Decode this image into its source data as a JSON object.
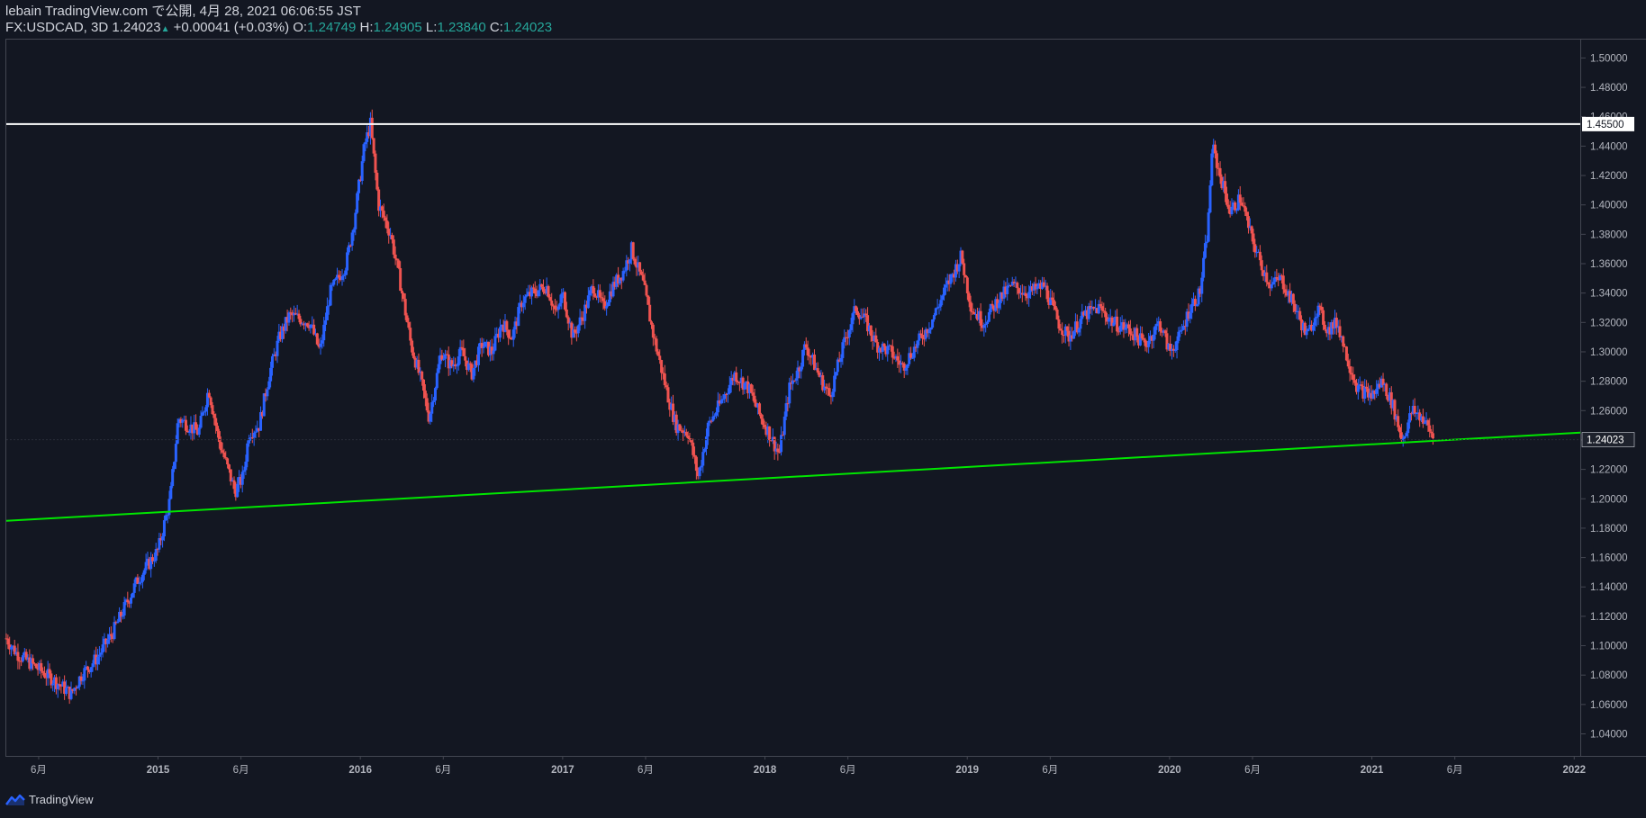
{
  "header": {
    "line1": "lebain TradingView.com で公開, 4月 28, 2021 06:06:55 JST",
    "symbol": "FX:USDCAD, 3D 1.24023",
    "change_icon": "up-triangle-icon",
    "change": "+0.00041 (+0.03%)",
    "open_label": "O:",
    "open": "1.24749",
    "high_label": "H:",
    "high": "1.24905",
    "low_label": "L:",
    "low": "1.23840",
    "close_label": "C:",
    "close": "1.24023"
  },
  "footer": {
    "brand": "TradingView",
    "logo_icon": "tradingview-logo-icon"
  },
  "colors": {
    "background": "#131722",
    "up": "#2962ff",
    "down": "#ef5350",
    "resistance": "#ffffff",
    "support": "#00e600",
    "axis_text": "#b2b5be"
  },
  "chart_data": {
    "type": "candlestick",
    "symbol": "FX:USDCAD",
    "interval": "3D",
    "ylim": [
      1.025,
      1.5125
    ],
    "xlim": [
      2014.25,
      2022.03
    ],
    "y_ticks": [
      "1.50000",
      "1.48000",
      "1.46000",
      "1.44000",
      "1.42000",
      "1.40000",
      "1.38000",
      "1.36000",
      "1.34000",
      "1.32000",
      "1.30000",
      "1.28000",
      "1.26000",
      "1.24000",
      "1.22000",
      "1.20000",
      "1.18000",
      "1.16000",
      "1.14000",
      "1.12000",
      "1.10000",
      "1.08000",
      "1.06000",
      "1.04000"
    ],
    "x_ticks": [
      {
        "label": "6月",
        "t": 2014.41
      },
      {
        "label": "2015",
        "t": 2015.0
      },
      {
        "label": "6月",
        "t": 2015.41
      },
      {
        "label": "2016",
        "t": 2016.0
      },
      {
        "label": "6月",
        "t": 2016.41
      },
      {
        "label": "2017",
        "t": 2017.0
      },
      {
        "label": "6月",
        "t": 2017.41
      },
      {
        "label": "2018",
        "t": 2018.0
      },
      {
        "label": "6月",
        "t": 2018.41
      },
      {
        "label": "2019",
        "t": 2019.0
      },
      {
        "label": "6月",
        "t": 2019.41
      },
      {
        "label": "2020",
        "t": 2020.0
      },
      {
        "label": "6月",
        "t": 2020.41
      },
      {
        "label": "2021",
        "t": 2021.0
      },
      {
        "label": "6月",
        "t": 2021.41
      },
      {
        "label": "2022",
        "t": 2022.0
      }
    ],
    "price_path": [
      [
        2014.25,
        1.105
      ],
      [
        2014.3,
        1.095
      ],
      [
        2014.4,
        1.085
      ],
      [
        2014.5,
        1.075
      ],
      [
        2014.57,
        1.067
      ],
      [
        2014.62,
        1.08
      ],
      [
        2014.7,
        1.092
      ],
      [
        2014.78,
        1.11
      ],
      [
        2014.9,
        1.145
      ],
      [
        2015.0,
        1.165
      ],
      [
        2015.06,
        1.2
      ],
      [
        2015.1,
        1.255
      ],
      [
        2015.2,
        1.245
      ],
      [
        2015.25,
        1.275
      ],
      [
        2015.3,
        1.24
      ],
      [
        2015.38,
        1.205
      ],
      [
        2015.42,
        1.215
      ],
      [
        2015.45,
        1.245
      ],
      [
        2015.5,
        1.25
      ],
      [
        2015.55,
        1.285
      ],
      [
        2015.6,
        1.31
      ],
      [
        2015.65,
        1.325
      ],
      [
        2015.75,
        1.32
      ],
      [
        2015.8,
        1.3
      ],
      [
        2015.85,
        1.34
      ],
      [
        2015.93,
        1.36
      ],
      [
        2015.97,
        1.39
      ],
      [
        2016.02,
        1.44
      ],
      [
        2016.05,
        1.455
      ],
      [
        2016.09,
        1.4
      ],
      [
        2016.15,
        1.38
      ],
      [
        2016.2,
        1.345
      ],
      [
        2016.25,
        1.305
      ],
      [
        2016.3,
        1.28
      ],
      [
        2016.34,
        1.255
      ],
      [
        2016.4,
        1.3
      ],
      [
        2016.45,
        1.29
      ],
      [
        2016.5,
        1.3
      ],
      [
        2016.55,
        1.285
      ],
      [
        2016.6,
        1.305
      ],
      [
        2016.65,
        1.3
      ],
      [
        2016.7,
        1.32
      ],
      [
        2016.75,
        1.31
      ],
      [
        2016.8,
        1.335
      ],
      [
        2016.85,
        1.34
      ],
      [
        2016.92,
        1.345
      ],
      [
        2016.97,
        1.325
      ],
      [
        2017.0,
        1.34
      ],
      [
        2017.05,
        1.31
      ],
      [
        2017.1,
        1.325
      ],
      [
        2017.15,
        1.345
      ],
      [
        2017.2,
        1.33
      ],
      [
        2017.25,
        1.345
      ],
      [
        2017.3,
        1.355
      ],
      [
        2017.34,
        1.37
      ],
      [
        2017.4,
        1.345
      ],
      [
        2017.45,
        1.31
      ],
      [
        2017.52,
        1.27
      ],
      [
        2017.56,
        1.25
      ],
      [
        2017.62,
        1.245
      ],
      [
        2017.67,
        1.215
      ],
      [
        2017.72,
        1.25
      ],
      [
        2017.78,
        1.265
      ],
      [
        2017.85,
        1.285
      ],
      [
        2017.92,
        1.275
      ],
      [
        2017.98,
        1.255
      ],
      [
        2018.02,
        1.245
      ],
      [
        2018.07,
        1.23
      ],
      [
        2018.12,
        1.275
      ],
      [
        2018.17,
        1.29
      ],
      [
        2018.2,
        1.305
      ],
      [
        2018.28,
        1.28
      ],
      [
        2018.32,
        1.27
      ],
      [
        2018.4,
        1.31
      ],
      [
        2018.45,
        1.33
      ],
      [
        2018.5,
        1.32
      ],
      [
        2018.55,
        1.305
      ],
      [
        2018.62,
        1.3
      ],
      [
        2018.68,
        1.29
      ],
      [
        2018.75,
        1.305
      ],
      [
        2018.82,
        1.32
      ],
      [
        2018.9,
        1.345
      ],
      [
        2018.97,
        1.365
      ],
      [
        2019.02,
        1.33
      ],
      [
        2019.08,
        1.32
      ],
      [
        2019.15,
        1.335
      ],
      [
        2019.22,
        1.345
      ],
      [
        2019.3,
        1.34
      ],
      [
        2019.38,
        1.345
      ],
      [
        2019.45,
        1.32
      ],
      [
        2019.5,
        1.31
      ],
      [
        2019.58,
        1.325
      ],
      [
        2019.65,
        1.33
      ],
      [
        2019.72,
        1.32
      ],
      [
        2019.8,
        1.315
      ],
      [
        2019.88,
        1.305
      ],
      [
        2019.95,
        1.32
      ],
      [
        2020.0,
        1.3
      ],
      [
        2020.05,
        1.31
      ],
      [
        2020.1,
        1.33
      ],
      [
        2020.15,
        1.34
      ],
      [
        2020.19,
        1.385
      ],
      [
        2020.21,
        1.44
      ],
      [
        2020.25,
        1.42
      ],
      [
        2020.3,
        1.395
      ],
      [
        2020.35,
        1.405
      ],
      [
        2020.4,
        1.38
      ],
      [
        2020.45,
        1.36
      ],
      [
        2020.5,
        1.345
      ],
      [
        2020.55,
        1.35
      ],
      [
        2020.62,
        1.33
      ],
      [
        2020.68,
        1.31
      ],
      [
        2020.73,
        1.33
      ],
      [
        2020.78,
        1.315
      ],
      [
        2020.83,
        1.32
      ],
      [
        2020.88,
        1.295
      ],
      [
        2020.93,
        1.275
      ],
      [
        2021.0,
        1.27
      ],
      [
        2021.05,
        1.28
      ],
      [
        2021.1,
        1.265
      ],
      [
        2021.15,
        1.24
      ],
      [
        2021.2,
        1.26
      ],
      [
        2021.25,
        1.255
      ],
      [
        2021.31,
        1.24
      ]
    ],
    "resistance": {
      "price": 1.455,
      "label": "1.45500"
    },
    "support": {
      "start": [
        2014.25,
        1.185
      ],
      "end": [
        2022.03,
        1.245
      ]
    },
    "last_price": {
      "value": 1.24023,
      "label": "1.24023"
    }
  }
}
